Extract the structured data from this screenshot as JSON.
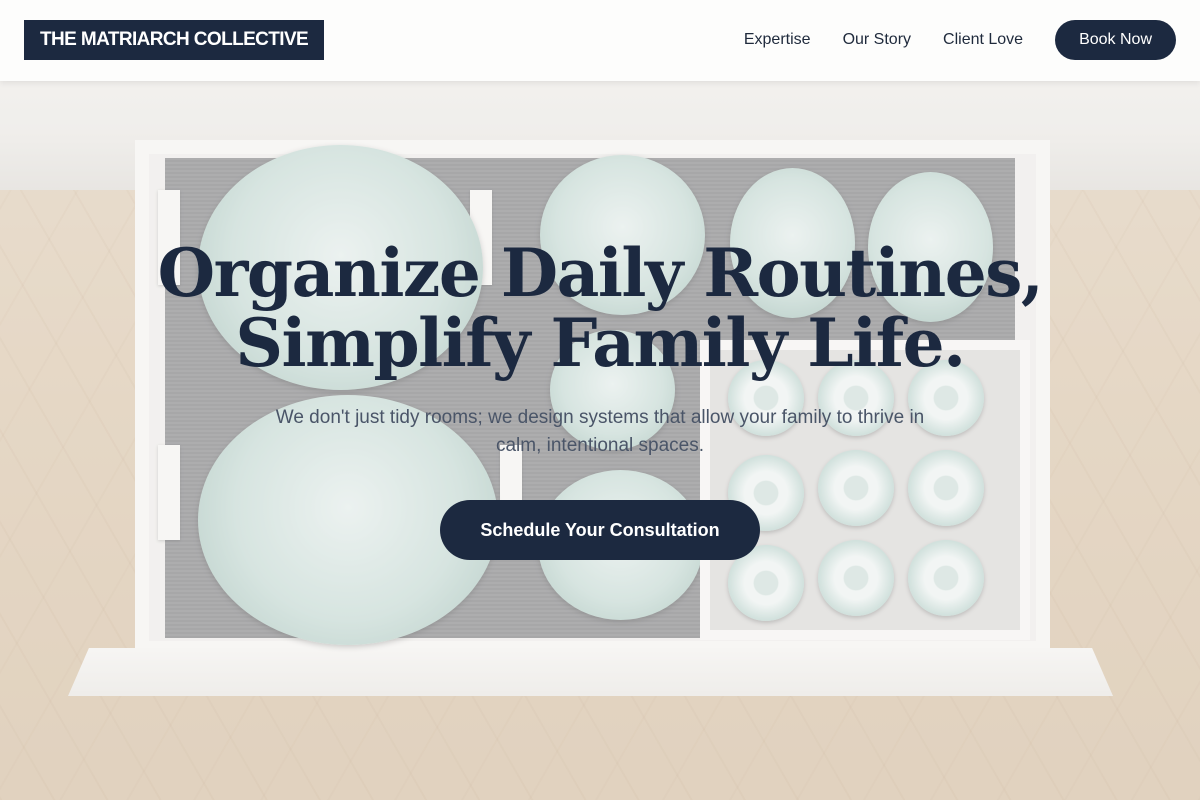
{
  "header": {
    "logo_text": "THE MATRIARCH COLLECTIVE",
    "nav": [
      {
        "label": "Expertise"
      },
      {
        "label": "Our Story"
      },
      {
        "label": "Client Love"
      }
    ],
    "cta_label": "Book Now"
  },
  "hero": {
    "title_line1": "Organize Daily Routines,",
    "title_line2": "Simplify Family Life.",
    "subtitle": "We don't just tidy rooms; we design systems that allow your family to thrive in calm, intentional spaces.",
    "cta_label": "Schedule Your Consultation",
    "background_image": "kitchen drawer with organized plates, bowls and cups"
  },
  "colors": {
    "navy": "#1c2940",
    "text_muted": "#4a5568",
    "header_bg": "#fdfdfc"
  }
}
